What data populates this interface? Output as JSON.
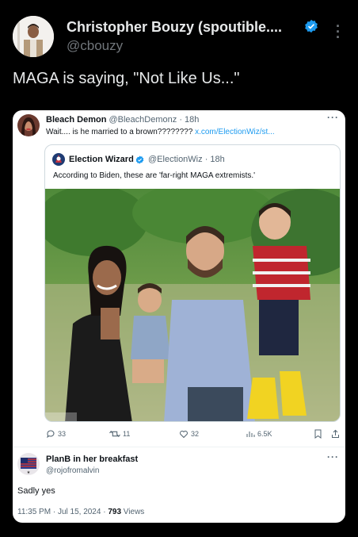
{
  "tweet": {
    "author_name": "Christopher Bouzy (spoutible....",
    "author_handle": "@cbouzy",
    "text": "MAGA is saying, \"Not Like Us...\""
  },
  "screenshot": {
    "reply_to": {
      "name": "Bleach Demon",
      "handle": "@BleachDemonz",
      "age": "· 18h",
      "text": "Wait.... is he married to a brown????????",
      "link": "x.com/ElectionWiz/st..."
    },
    "quoted": {
      "name": "Election Wizard",
      "handle": "@ElectionWiz",
      "age": "· 18h",
      "text": "According to Biden, these are 'far-right MAGA extremists.'"
    },
    "actions": {
      "replies": "33",
      "retweets": "11",
      "likes": "32",
      "views": "6.5K"
    },
    "reply": {
      "name": "PlanB in her breakfast",
      "handle": "@rojofromalvin",
      "text": "Sadly yes",
      "timestamp": "11:35 PM · Jul 15, 2024 · ",
      "views_count": "793",
      "views_label": " Views"
    }
  },
  "colors": {
    "background": "#000000",
    "verified": "#1d9bf0",
    "link": "#1d9bf0",
    "muted": "#71767b"
  },
  "icons": [
    "verified-badge-icon",
    "more-options-icon",
    "reply-icon",
    "retweet-icon",
    "like-icon",
    "views-icon",
    "bookmark-icon",
    "share-icon"
  ]
}
